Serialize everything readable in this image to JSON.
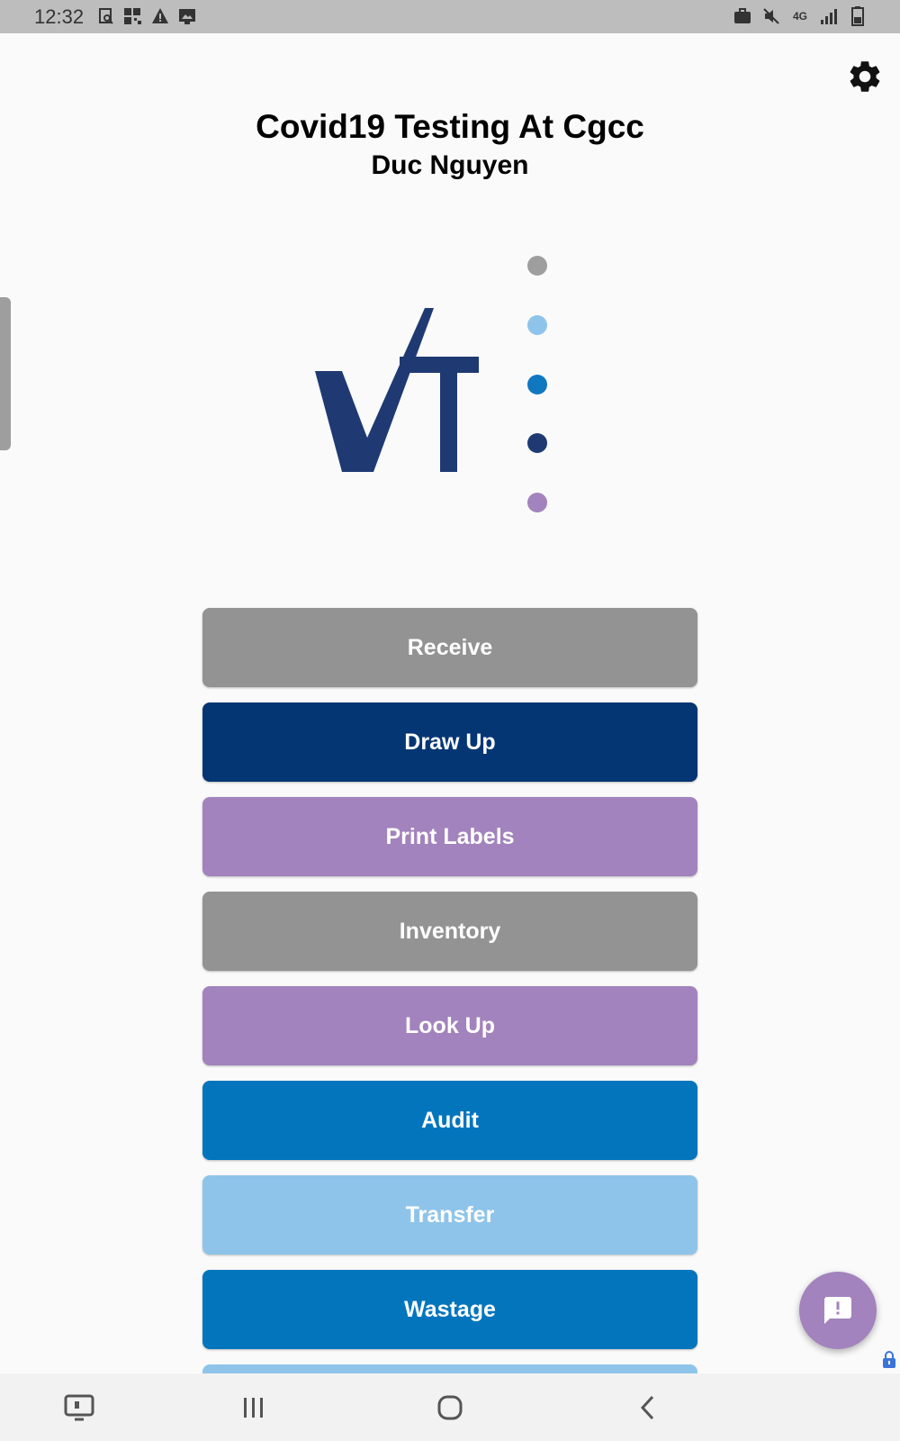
{
  "status_bar": {
    "time": "12:32",
    "left_icons": [
      "screenshot-icon",
      "qr-scan-icon",
      "warning-icon",
      "image-icon"
    ],
    "right_icons": [
      "briefcase-icon",
      "mute-icon",
      "network-4g-icon",
      "signal-icon",
      "battery-icon"
    ],
    "network_label": "4G"
  },
  "header": {
    "title": "Covid19 Testing At Cgcc",
    "user_name": "Duc Nguyen"
  },
  "logo": {
    "text": "VT",
    "color": "#1f3a73",
    "dot_colors": [
      "#9e9e9e",
      "#8fc4ea",
      "#1077c1",
      "#1f3a73",
      "#a283bd"
    ]
  },
  "menu": {
    "buttons": [
      {
        "label": "Receive",
        "color": "#939393"
      },
      {
        "label": "Draw Up",
        "color": "#043673"
      },
      {
        "label": "Print Labels",
        "color": "#a283bd"
      },
      {
        "label": "Inventory",
        "color": "#939393"
      },
      {
        "label": "Look Up",
        "color": "#a283bd"
      },
      {
        "label": "Audit",
        "color": "#0375bd"
      },
      {
        "label": "Transfer",
        "color": "#8fc4ea"
      },
      {
        "label": "Wastage",
        "color": "#0375bd"
      }
    ],
    "partial_next_color": "#8fc4ea"
  },
  "fab": {
    "icon": "feedback-icon",
    "color": "#a283bd"
  },
  "nav_bar": {
    "icons": [
      "screen-icon",
      "recent-apps-icon",
      "home-icon",
      "back-icon"
    ]
  }
}
